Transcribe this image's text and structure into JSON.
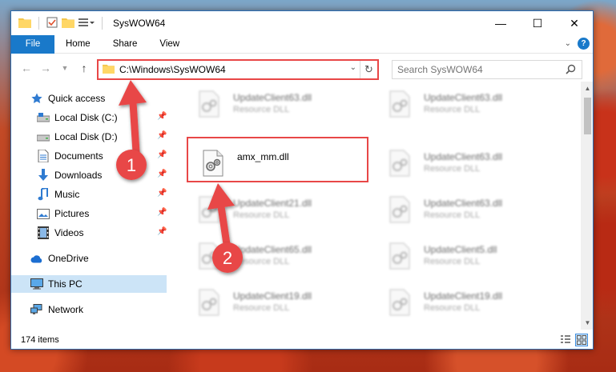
{
  "window": {
    "title": "SysWOW64",
    "buttons": {
      "minimize": "—",
      "maximize": "☐",
      "close": "✕"
    }
  },
  "ribbon": {
    "tabs": [
      "File",
      "Home",
      "Share",
      "View"
    ]
  },
  "address": {
    "path": "C:\\Windows\\SysWOW64",
    "search_placeholder": "Search SysWOW64"
  },
  "sidebar": {
    "items": [
      {
        "label": "Quick access",
        "icon": "star-icon",
        "pinned": false
      },
      {
        "label": "Local Disk (C:)",
        "icon": "drive-icon",
        "pinned": true
      },
      {
        "label": "Local Disk (D:)",
        "icon": "drive-icon",
        "pinned": true
      },
      {
        "label": "Documents",
        "icon": "documents-icon",
        "pinned": true
      },
      {
        "label": "Downloads",
        "icon": "download-icon",
        "pinned": true
      },
      {
        "label": "Music",
        "icon": "music-icon",
        "pinned": true
      },
      {
        "label": "Pictures",
        "icon": "pictures-icon",
        "pinned": true
      },
      {
        "label": "Videos",
        "icon": "videos-icon",
        "pinned": true
      },
      {
        "label": "OneDrive",
        "icon": "cloud-icon",
        "pinned": false
      },
      {
        "label": "This PC",
        "icon": "computer-icon",
        "pinned": false,
        "selected": true
      },
      {
        "label": "Network",
        "icon": "network-icon",
        "pinned": false
      }
    ]
  },
  "files": {
    "left_column": [
      {
        "name": "UpdateClient63.dll",
        "type": "Resource DLL",
        "blurred": true
      },
      {
        "name": "amx_mm.dll",
        "type": "",
        "blurred": false,
        "highlighted": true
      },
      {
        "name": "UpdateClient21.dll",
        "type": "Resource DLL",
        "blurred": true
      },
      {
        "name": "UpdateClient65.dll",
        "type": "Resource DLL",
        "blurred": true
      },
      {
        "name": "UpdateClient19.dll",
        "type": "Resource DLL",
        "blurred": true
      }
    ],
    "right_column": [
      {
        "name": "UpdateClient63.dll",
        "type": "Resource DLL",
        "blurred": true
      },
      {
        "name": "UpdateClient63.dll",
        "type": "Resource DLL",
        "blurred": true
      },
      {
        "name": "UpdateClient63.dll",
        "type": "Resource DLL",
        "blurred": true
      },
      {
        "name": "UpdateClient5.dll",
        "type": "Resource DLL",
        "blurred": true
      },
      {
        "name": "UpdateClient19.dll",
        "type": "Resource DLL",
        "blurred": true
      }
    ]
  },
  "status": {
    "item_count": "174 items"
  },
  "annotations": {
    "step1": "1",
    "step2": "2",
    "color": "#e84747"
  },
  "colors": {
    "accent": "#1979ca",
    "selection": "#cce4f7",
    "highlight_red": "#e84747"
  }
}
